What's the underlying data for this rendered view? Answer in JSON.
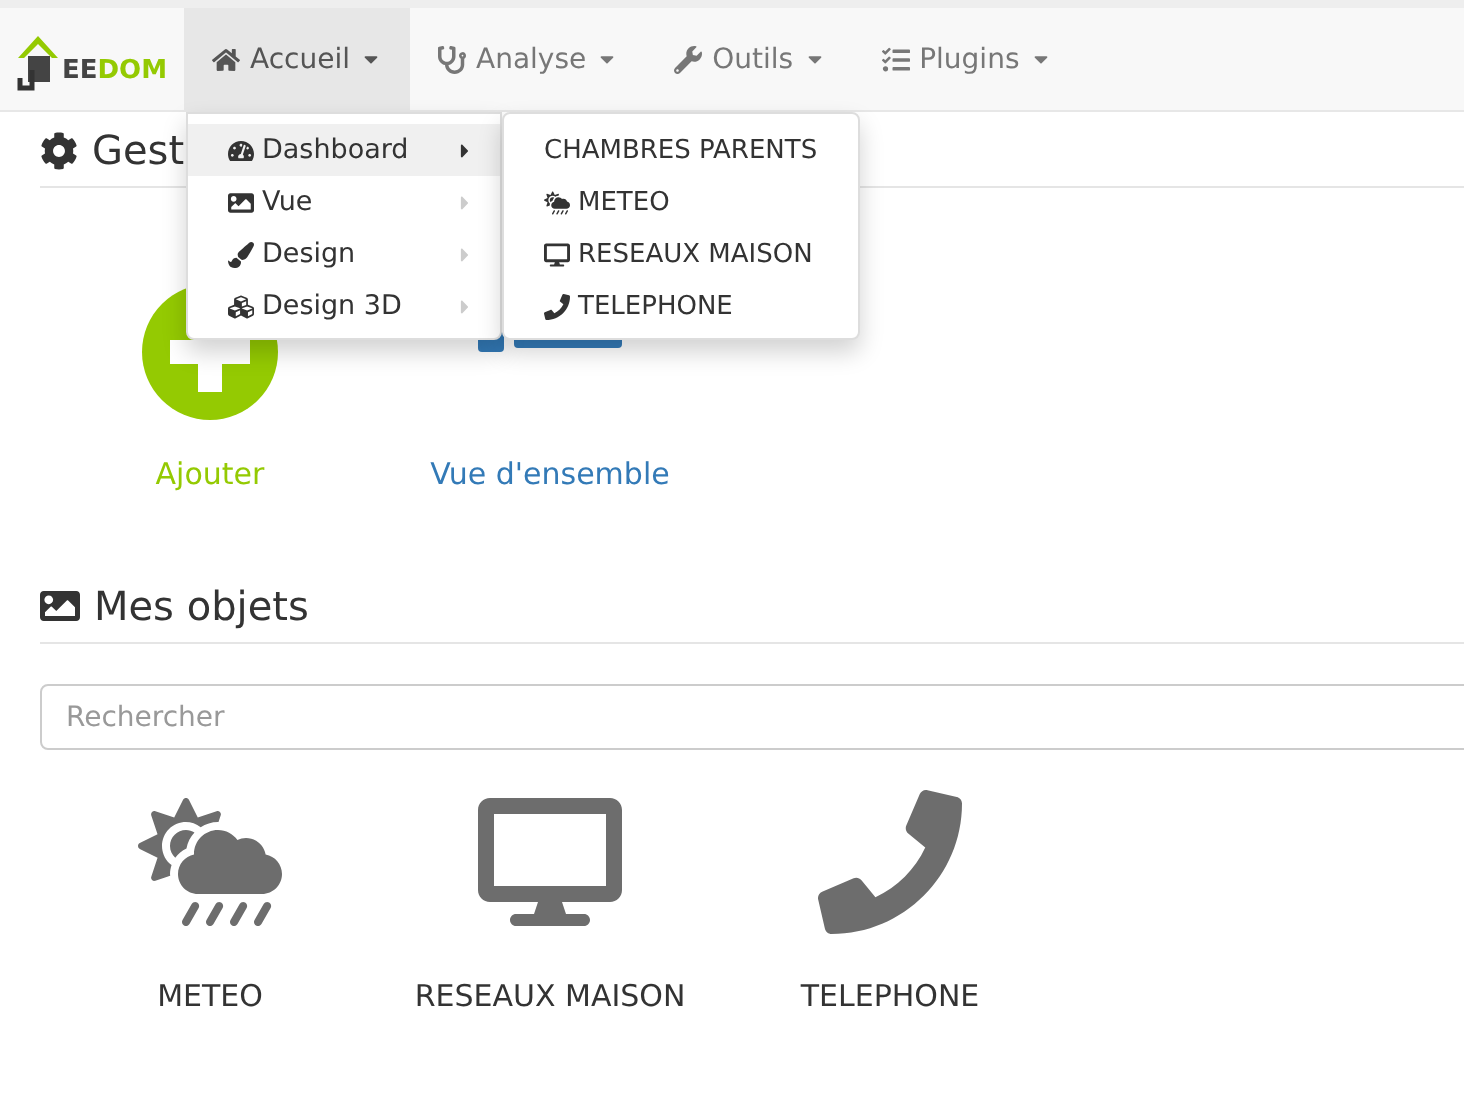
{
  "logo": {
    "dark": "EE",
    "accent": "DOM"
  },
  "nav": [
    {
      "label": "Accueil",
      "selected": true
    },
    {
      "label": "Analyse",
      "selected": false
    },
    {
      "label": "Outils",
      "selected": false
    },
    {
      "label": "Plugins",
      "selected": false
    }
  ],
  "menu": [
    {
      "label": "Dashboard",
      "selected": true
    },
    {
      "label": "Vue",
      "selected": false
    },
    {
      "label": "Design",
      "selected": false
    },
    {
      "label": "Design 3D",
      "selected": false
    }
  ],
  "submenu": [
    {
      "label": "CHAMBRES PARENTS"
    },
    {
      "label": "METEO"
    },
    {
      "label": "RESEAUX MAISON"
    },
    {
      "label": "TELEPHONE"
    }
  ],
  "management": {
    "title": "Gest",
    "actions": [
      {
        "label": "Ajouter",
        "kind": "add"
      },
      {
        "label": "Vue d'ensemble",
        "kind": "overview"
      }
    ]
  },
  "objects": {
    "title": "Mes objets",
    "search": {
      "placeholder": "Rechercher"
    },
    "items": [
      {
        "label": "METEO"
      },
      {
        "label": "RESEAUX MAISON"
      },
      {
        "label": "TELEPHONE"
      }
    ]
  }
}
